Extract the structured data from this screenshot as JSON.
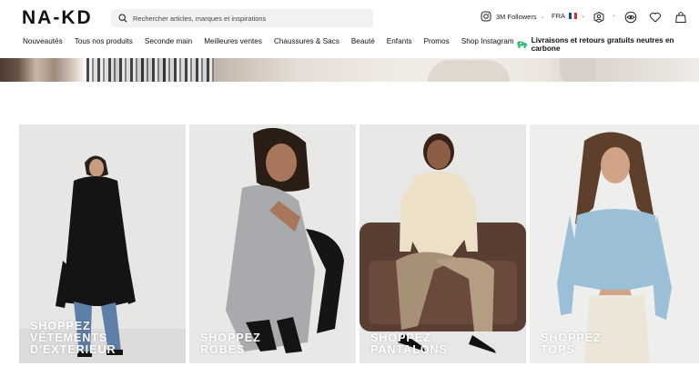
{
  "header": {
    "logo": "NA-KD",
    "search_placeholder": "Rechercher articles, marques et inspirations",
    "instagram_followers": "3M Followers",
    "language": "FRA"
  },
  "nav": {
    "items": [
      "Nouveautés",
      "Tous nos produits",
      "Seconde main",
      "Meilleures ventes",
      "Chaussures & Sacs",
      "Beauté",
      "Enfants",
      "Promos",
      "Shop Instagram"
    ],
    "promo_text": "Livraisons et retours gratuits neutres en carbone"
  },
  "tiles": [
    {
      "lines": [
        "Shoppez",
        "vêtements",
        "d'extérieur"
      ]
    },
    {
      "lines": [
        "Shoppez",
        "robes"
      ]
    },
    {
      "lines": [
        "Shoppez",
        "pantalons"
      ]
    },
    {
      "lines": [
        "Shoppez",
        "tops"
      ]
    }
  ],
  "colors": {
    "accent_green": "#2bb673",
    "search_bg": "#f2f2f2",
    "flag_blue": "#1f3fa8",
    "flag_red": "#e0302f"
  }
}
